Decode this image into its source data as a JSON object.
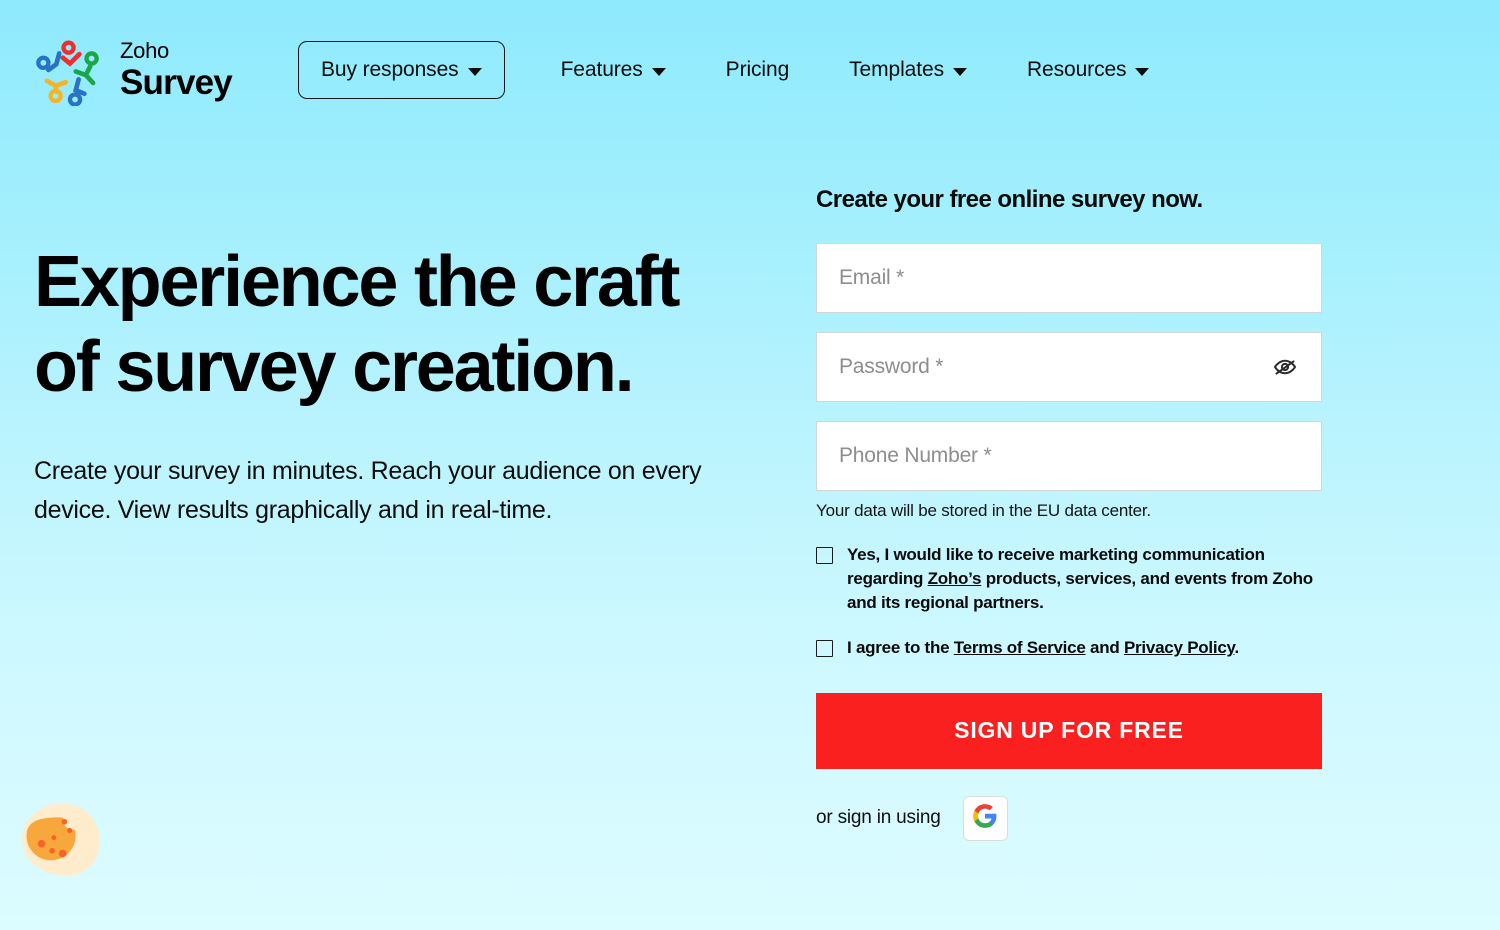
{
  "brand": {
    "name": "Zoho",
    "product": "Survey",
    "logo_icon": "zoho-pinwheel-logo"
  },
  "nav": {
    "items": [
      {
        "label": "Buy responses",
        "has_caret": true,
        "boxed": true
      },
      {
        "label": "Features",
        "has_caret": true,
        "boxed": false
      },
      {
        "label": "Pricing",
        "has_caret": false,
        "boxed": false
      },
      {
        "label": "Templates",
        "has_caret": true,
        "boxed": false
      },
      {
        "label": "Resources",
        "has_caret": true,
        "boxed": false
      }
    ]
  },
  "hero": {
    "title_line1": "Experience the craft",
    "title_line2": "of survey creation.",
    "subtitle": "Create your survey in minutes. Reach your audience on every device. View results graphically and in real-time."
  },
  "signup": {
    "title": "Create your free online survey now.",
    "fields": {
      "email": {
        "placeholder": "Email *",
        "value": ""
      },
      "password": {
        "placeholder": "Password *",
        "value": "",
        "toggle_icon": "eye-off-icon"
      },
      "phone": {
        "placeholder": "Phone Number *",
        "value": ""
      }
    },
    "data_center_note": "Your data will be stored in the EU data center.",
    "marketing_consent": {
      "text_part1": "Yes, I would like to receive marketing communication regarding ",
      "link1": "Zoho’s",
      "text_part2": " products, services, and events from Zoho and its regional partners.",
      "checked": false
    },
    "terms_consent": {
      "text_part1": "I agree to the ",
      "link1": "Terms of Service",
      "text_part2": " and ",
      "link2": "Privacy Policy",
      "text_part3": ".",
      "checked": false
    },
    "submit_label": "SIGN UP FOR FREE",
    "social_label": "or sign in using",
    "social_icon": "google-g-icon"
  },
  "cookie_widget": {
    "icon": "cookie-icon"
  },
  "colors": {
    "background_top": "#8eeafd",
    "background_bottom": "#dcfcff",
    "submit_red": "#fa2020",
    "field_white": "#ffffff",
    "field_border": "#d5d5d5",
    "text_black": "#000000",
    "cookie_bg": "#ffeccc",
    "cookie_body": "#f8a73c",
    "cookie_chip": "#f9622a"
  }
}
